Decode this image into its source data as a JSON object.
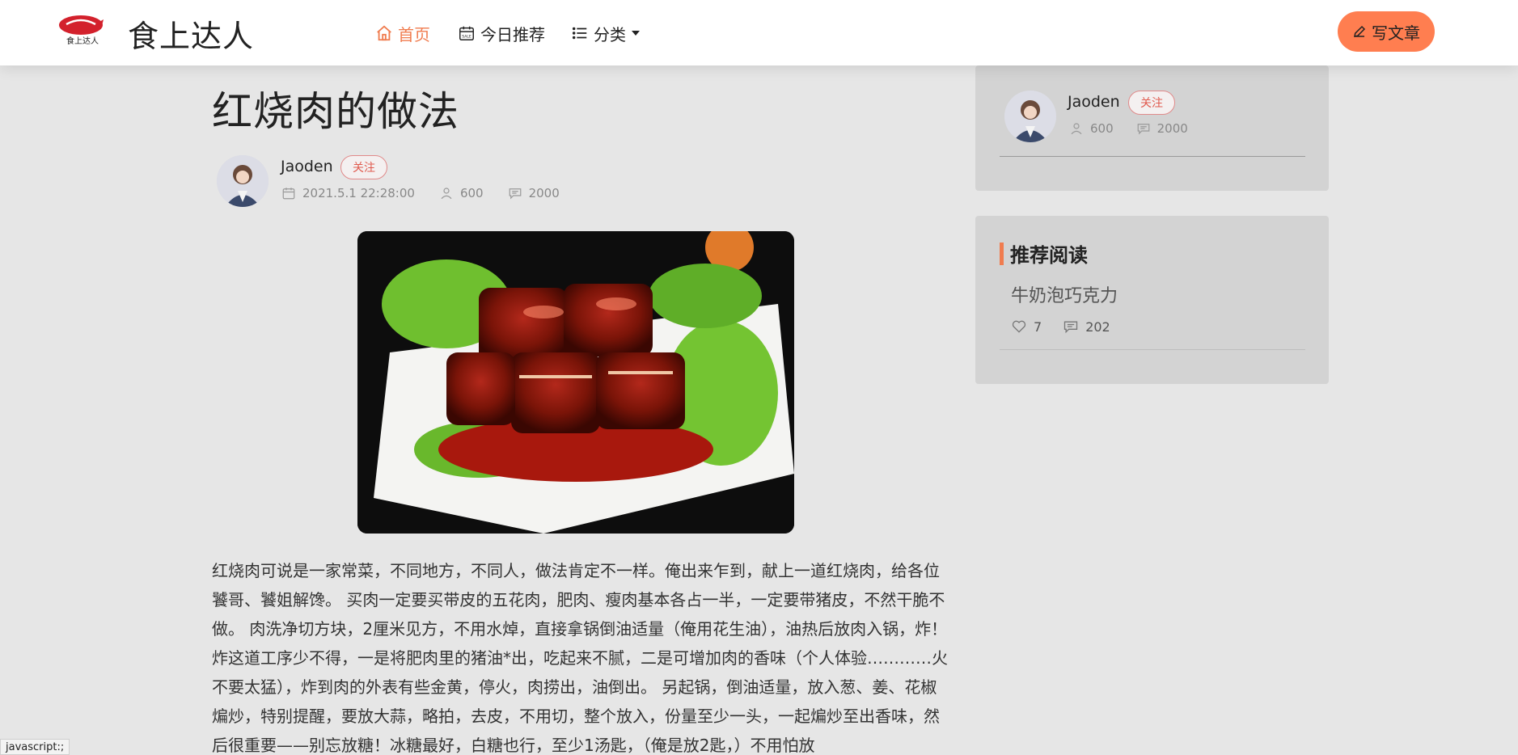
{
  "header": {
    "logo_text": "食上达人",
    "brand": "食上达人",
    "nav": [
      {
        "label": "首页",
        "icon": "home-icon",
        "active": true
      },
      {
        "label": "今日推荐",
        "icon": "calendar-icon",
        "active": false
      },
      {
        "label": "分类",
        "icon": "list-icon",
        "active": false
      }
    ],
    "write_label": "写文章"
  },
  "article": {
    "title": "红烧肉的做法",
    "author": "Jaoden",
    "follow_label": "关注",
    "date": "2021.5.1 22:28:00",
    "views": "600",
    "comments": "2000",
    "body": "红烧肉可说是一家常菜，不同地方，不同人，做法肯定不一样。俺出来乍到，献上一道红烧肉，给各位饕哥、饕姐解馋。 买肉一定要买带皮的五花肉，肥肉、瘦肉基本各占一半，一定要带猪皮，不然干脆不做。 肉洗净切方块，2厘米见方，不用水焯，直接拿锅倒油适量（俺用花生油），油热后放肉入锅，炸！炸这道工序少不得，一是将肥肉里的猪油*出，吃起来不腻，二是可增加肉的香味（个人体验…………火不要太猛），炸到肉的外表有些金黄，停火，肉捞出，油倒出。 另起锅，倒油适量，放入葱、姜、花椒煸炒，特别提醒，要放大蒜，略拍，去皮，不用切，整个放入，份量至少一头，一起煸炒至出香味，然后很重要——别忘放糖！冰糖最好，白糖也行，至少1汤匙，（俺是放2匙，）不用怕放"
  },
  "sidebar": {
    "author": "Jaoden",
    "follow_label": "关注",
    "views": "600",
    "comments": "2000",
    "section_title": "推荐阅读",
    "recommend": [
      {
        "title": "牛奶泡巧克力",
        "likes": "7",
        "comments": "202"
      }
    ]
  },
  "status_bar": "javascript:;",
  "colors": {
    "accent": "#f07c4f",
    "button": "#ff7e50",
    "background": "#e6e6e6"
  }
}
